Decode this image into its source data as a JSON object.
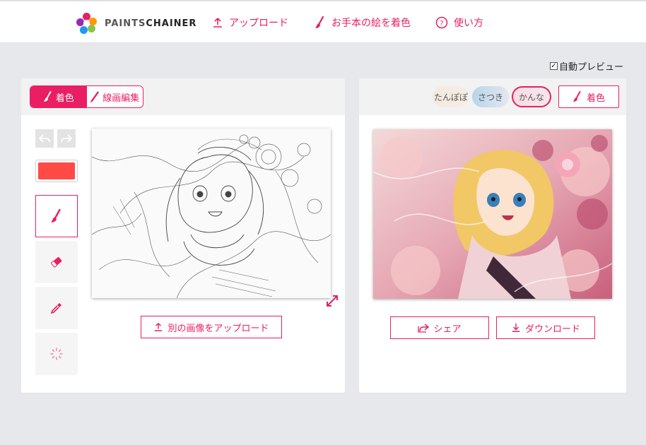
{
  "header": {
    "logo_text_a": "PAINTS",
    "logo_text_b": "CHAINER",
    "nav_upload": "アップロード",
    "nav_sample": "お手本の絵を着色",
    "nav_howto": "使い方",
    "accent": "#e91e63"
  },
  "auto_preview": {
    "label": "自動プレビュー",
    "checked": true
  },
  "left_panel": {
    "mode_colorize": "着色",
    "mode_lineedit": "線画編集",
    "current_color": "#ff4a45",
    "tools": [
      "brush-icon",
      "eraser-icon",
      "eyedropper-icon",
      "loading-icon"
    ],
    "upload_other": "別の画像をアップロード"
  },
  "right_panel": {
    "styles": [
      "たんぽぽ",
      "さつき",
      "かんな"
    ],
    "selected_style": "かんな",
    "colorize_button": "着色",
    "share_button": "シェア",
    "download_button": "ダウンロード"
  }
}
